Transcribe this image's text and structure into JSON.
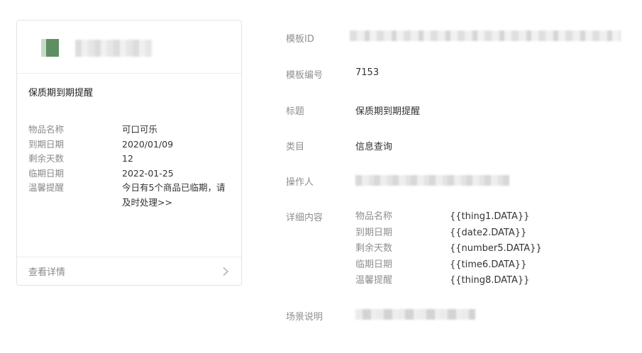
{
  "preview_card": {
    "title": "保质期到期提醒",
    "rows": [
      {
        "key": "物品名称",
        "value": "可口可乐"
      },
      {
        "key": "到期日期",
        "value": "2020/01/09"
      },
      {
        "key": "剩余天数",
        "value": "12"
      },
      {
        "key": "临期日期",
        "value": "2022-01-25"
      },
      {
        "key": "温馨提醒",
        "value": "今日有5个商品已临期，请及时处理>>"
      }
    ],
    "footer_label": "查看详情",
    "footer_icon": "chevron-right-icon"
  },
  "details": {
    "template_id_label": "模板ID",
    "template_no_label": "模板编号",
    "template_no": "7153",
    "title_label": "标题",
    "title": "保质期到期提醒",
    "category_label": "类目",
    "category": "信息查询",
    "operator_label": "操作人",
    "content_label": "详细内容",
    "content_rows": [
      {
        "key": "物品名称",
        "value": "{{thing1.DATA}}"
      },
      {
        "key": "到期日期",
        "value": "{{date2.DATA}}"
      },
      {
        "key": "剩余天数",
        "value": "{{number5.DATA}}"
      },
      {
        "key": "临期日期",
        "value": "{{time6.DATA}}"
      },
      {
        "key": "温馨提醒",
        "value": "{{thing8.DATA}}"
      }
    ],
    "scene_label": "场景说明"
  },
  "colors": {
    "label_gray": "#8f8f8f",
    "text": "#333333",
    "border": "#e3e3e3",
    "avatar_green": "#5f8e63"
  }
}
